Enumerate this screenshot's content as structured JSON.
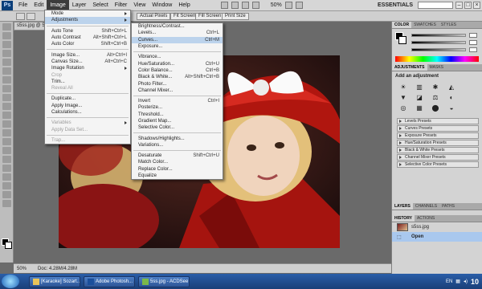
{
  "menubar": {
    "logo": "Ps",
    "items": [
      "File",
      "Edit",
      "Image",
      "Layer",
      "Select",
      "Filter",
      "View",
      "Window",
      "Help"
    ],
    "zoom": "50%",
    "workspace": "ESSENTIALS"
  },
  "optionsbar": {
    "buttons": [
      "Actual Pixels",
      "Fit Screen",
      "Fill Screen",
      "Print Size"
    ]
  },
  "document": {
    "tab": "s5ss.jpg @ 5",
    "status_zoom": "50%",
    "status_doc": "Doc: 4.28M/4.28M"
  },
  "image_menu": {
    "sections": [
      [
        {
          "label": "Mode",
          "submenu": true
        },
        {
          "label": "Adjustments",
          "submenu": true,
          "highlight": true
        }
      ],
      [
        {
          "label": "Auto Tone",
          "shortcut": "Shift+Ctrl+L"
        },
        {
          "label": "Auto Contrast",
          "shortcut": "Alt+Shift+Ctrl+L"
        },
        {
          "label": "Auto Color",
          "shortcut": "Shift+Ctrl+B"
        }
      ],
      [
        {
          "label": "Image Size...",
          "shortcut": "Alt+Ctrl+I"
        },
        {
          "label": "Canvas Size...",
          "shortcut": "Alt+Ctrl+C"
        },
        {
          "label": "Image Rotation",
          "submenu": true
        },
        {
          "label": "Crop",
          "disabled": true
        },
        {
          "label": "Trim..."
        },
        {
          "label": "Reveal All",
          "disabled": true
        }
      ],
      [
        {
          "label": "Duplicate..."
        },
        {
          "label": "Apply Image..."
        },
        {
          "label": "Calculations..."
        }
      ],
      [
        {
          "label": "Variables",
          "submenu": true,
          "disabled": true
        },
        {
          "label": "Apply Data Set...",
          "disabled": true
        }
      ],
      [
        {
          "label": "Trap...",
          "disabled": true
        }
      ]
    ]
  },
  "adjustments_menu": {
    "sections": [
      [
        {
          "label": "Brightness/Contrast..."
        },
        {
          "label": "Levels...",
          "shortcut": "Ctrl+L"
        },
        {
          "label": "Curves...",
          "shortcut": "Ctrl+M",
          "highlight": true
        },
        {
          "label": "Exposure..."
        }
      ],
      [
        {
          "label": "Vibrance..."
        },
        {
          "label": "Hue/Saturation...",
          "shortcut": "Ctrl+U"
        },
        {
          "label": "Color Balance...",
          "shortcut": "Ctrl+B"
        },
        {
          "label": "Black & White...",
          "shortcut": "Alt+Shift+Ctrl+B"
        },
        {
          "label": "Photo Filter..."
        },
        {
          "label": "Channel Mixer..."
        }
      ],
      [
        {
          "label": "Invert",
          "shortcut": "Ctrl+I"
        },
        {
          "label": "Posterize..."
        },
        {
          "label": "Threshold..."
        },
        {
          "label": "Gradient Map..."
        },
        {
          "label": "Selective Color..."
        }
      ],
      [
        {
          "label": "Shadows/Highlights..."
        },
        {
          "label": "Variations..."
        }
      ],
      [
        {
          "label": "Desaturate",
          "shortcut": "Shift+Ctrl+U"
        },
        {
          "label": "Match Color..."
        },
        {
          "label": "Replace Color..."
        },
        {
          "label": "Equalize"
        }
      ]
    ]
  },
  "color_panel": {
    "tabs": [
      "COLOR",
      "SWATCHES",
      "STYLES"
    ]
  },
  "adjustments_panel": {
    "tabs": [
      "ADJUSTMENTS",
      "MASKS"
    ],
    "heading": "Add an adjustment",
    "icons": [
      "☀",
      "▥",
      "✱",
      "◭",
      "▼",
      "◪",
      "⚖",
      "◐",
      "◎",
      "▦",
      "⬤",
      "◒"
    ],
    "presets": [
      "Levels Presets",
      "Curves Presets",
      "Exposure Presets",
      "Hue/Saturation Presets",
      "Black & White Presets",
      "Channel Mixer Presets",
      "Selective Color Presets"
    ]
  },
  "layers_panel": {
    "tabs": [
      "LAYERS",
      "CHANNELS",
      "PATHS"
    ]
  },
  "history_panel": {
    "tabs": [
      "HISTORY",
      "ACTIONS"
    ],
    "items": [
      {
        "label": "s5ss.jpg",
        "selected": false
      },
      {
        "label": "Open",
        "selected": true
      }
    ]
  },
  "taskbar": {
    "buttons": [
      "[Karaoke] Sozart...",
      "Adobe Photosh...",
      "5ss.jpg - ACDSee Ph..."
    ],
    "lang": "EN",
    "clock": "10"
  }
}
